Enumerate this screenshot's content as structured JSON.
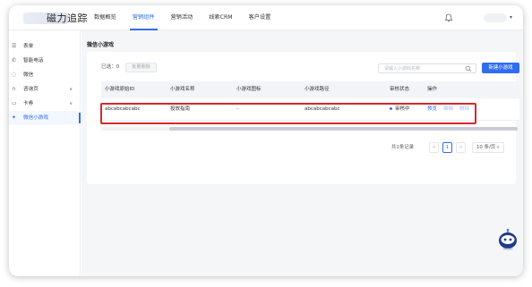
{
  "app": {
    "logo_text": "磁力追踪"
  },
  "topnav": {
    "items": [
      {
        "label": "数据概览"
      },
      {
        "label": "营销组件"
      },
      {
        "label": "营销活动"
      },
      {
        "label": "线索CRM"
      },
      {
        "label": "客户设置"
      }
    ],
    "active_index": 1
  },
  "sidebar": {
    "items": [
      {
        "label": "表单",
        "icon": "list-icon"
      },
      {
        "label": "智能电话",
        "icon": "phone-icon"
      },
      {
        "label": "微信",
        "icon": "wechat-icon"
      },
      {
        "label": "咨询页",
        "icon": "headset-icon",
        "has_arrow": true
      },
      {
        "label": "卡券",
        "icon": "ticket-icon",
        "has_arrow": true
      },
      {
        "label": "微信小游戏",
        "icon": "game-icon",
        "active": true
      }
    ]
  },
  "page": {
    "title": "微信小游戏"
  },
  "toolbar": {
    "selected_label": "已选：0",
    "batch_delete_label": "批量删除",
    "search_placeholder": "请输入小游戏名称",
    "new_button_label": "新建小游戏"
  },
  "table": {
    "columns": [
      "小游戏原始ID",
      "小游戏名称",
      "小游戏图标",
      "小游戏路径",
      "审核状态",
      "操作"
    ],
    "rows": [
      {
        "original_id": "abcabcabcabc",
        "name": "投放指南",
        "icon": "-",
        "path": "abcabcabcabc",
        "status": "审核中",
        "actions": {
          "preview": "预览",
          "edit": "编辑",
          "delete": "删除"
        }
      }
    ]
  },
  "pagination": {
    "total_label": "共1条记录",
    "prev": "<",
    "current_page": "1",
    "next": ">",
    "page_size": "10 条/页"
  },
  "colors": {
    "primary": "#2f6df0",
    "highlight": "#d8282b"
  }
}
